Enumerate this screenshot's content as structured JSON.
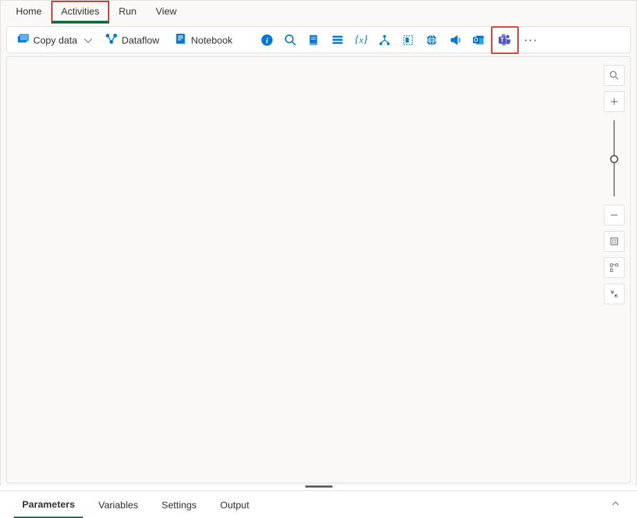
{
  "menu": {
    "items": [
      "Home",
      "Activities",
      "Run",
      "View"
    ],
    "activeIndex": 1
  },
  "toolbar": {
    "copyData": "Copy data",
    "dataflow": "Dataflow",
    "notebook": "Notebook",
    "icons": [
      {
        "name": "info-icon",
        "fill": "#0078d4"
      },
      {
        "name": "search-icon",
        "fill": "#0078d4"
      },
      {
        "name": "script-icon",
        "fill": "#0078d4"
      },
      {
        "name": "list-icon",
        "fill": "#0078d4"
      },
      {
        "name": "variable-icon",
        "fill": "#0078d4"
      },
      {
        "name": "branch-icon",
        "fill": "#0078d4"
      },
      {
        "name": "template-icon",
        "fill": "#0078d4"
      },
      {
        "name": "web-icon",
        "fill": "#0078d4"
      },
      {
        "name": "announcement-icon",
        "fill": "#0078d4"
      },
      {
        "name": "outlook-icon",
        "fill": "#0078d4"
      },
      {
        "name": "teams-icon",
        "fill": "#5059c9",
        "highlighted": true
      }
    ],
    "more": "..."
  },
  "tooltip": {
    "text": "Teams"
  },
  "bottomTabs": {
    "items": [
      "Parameters",
      "Variables",
      "Settings",
      "Output"
    ],
    "activeIndex": 0
  }
}
